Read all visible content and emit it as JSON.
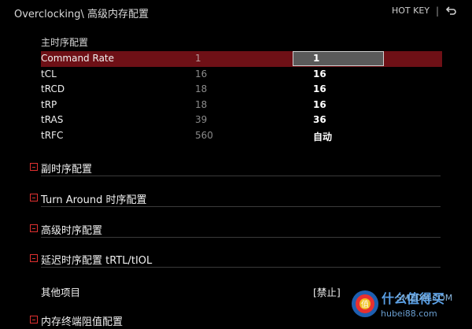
{
  "header": {
    "breadcrumb": "Overclocking\\ 高级内存配置",
    "hotkey_label": "HOT KEY",
    "separator": "|"
  },
  "primary_timings": {
    "title": "主时序配置",
    "rows": [
      {
        "name": "Command Rate",
        "current": "1",
        "setting": "1"
      },
      {
        "name": "tCL",
        "current": "16",
        "setting": "16"
      },
      {
        "name": "tRCD",
        "current": "18",
        "setting": "16"
      },
      {
        "name": "tRP",
        "current": "18",
        "setting": "16"
      },
      {
        "name": "tRAS",
        "current": "39",
        "setting": "36"
      },
      {
        "name": "tRFC",
        "current": "560",
        "setting": "自动"
      }
    ]
  },
  "sections": [
    {
      "label": "副时序配置"
    },
    {
      "label": "Turn Around 时序配置"
    },
    {
      "label": "高级时序配置"
    },
    {
      "label": "延迟时序配置 tRTL/tIOL"
    }
  ],
  "misc": {
    "name": "其他项目",
    "value": "[禁止]"
  },
  "last_section": {
    "label": "内存终端阻值配置"
  },
  "watermark": {
    "brand": "值",
    "text_top": "什么值得买",
    "text_bottom": "SMZDM.COM",
    "text_site": "hubei88.com"
  },
  "colors": {
    "selected_row": "#6e1016",
    "expander_icon": "#e03030",
    "background": "#000000"
  },
  "icons": {
    "back": "back-arrow-icon",
    "expander": "plus-box-icon"
  }
}
